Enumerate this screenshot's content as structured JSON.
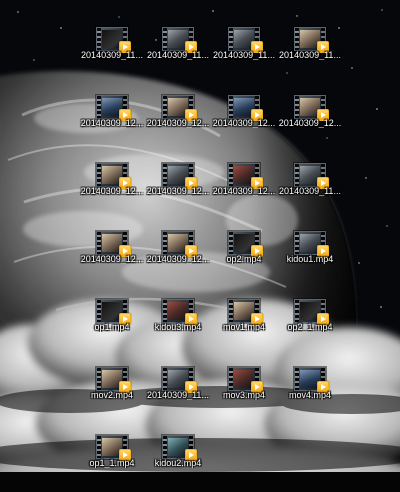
{
  "desktop": {
    "icons": [
      {
        "label": "20140309_11...",
        "thumb": "film-frame-icon",
        "tone": "dark"
      },
      {
        "label": "20140309_11...",
        "thumb": "film-frame-icon",
        "tone": "gray"
      },
      {
        "label": "20140309_11...",
        "thumb": "film-frame-icon",
        "tone": "gray"
      },
      {
        "label": "20140309_11...",
        "thumb": "film-frame-icon",
        "tone": "warm"
      },
      {
        "label": "20140309_12...",
        "thumb": "film-frame-icon",
        "tone": "blue"
      },
      {
        "label": "20140309_12...",
        "thumb": "film-frame-icon",
        "tone": "warm"
      },
      {
        "label": "20140309_12...",
        "thumb": "film-frame-icon",
        "tone": "blue"
      },
      {
        "label": "20140309_12...",
        "thumb": "film-frame-icon",
        "tone": "warm"
      },
      {
        "label": "20140309_12...",
        "thumb": "film-frame-icon",
        "tone": "warm"
      },
      {
        "label": "20140309_12...",
        "thumb": "film-frame-icon",
        "tone": "gray"
      },
      {
        "label": "20140309_12...",
        "thumb": "film-frame-icon",
        "tone": "red"
      },
      {
        "label": "20140309_11...",
        "thumb": "film-frame-icon",
        "tone": "gray"
      },
      {
        "label": "20140309_12...",
        "thumb": "film-frame-icon",
        "tone": "warm"
      },
      {
        "label": "20140309_12...",
        "thumb": "film-frame-icon",
        "tone": "warm"
      },
      {
        "label": "op2.mp4",
        "thumb": "film-frame-icon",
        "tone": "dark"
      },
      {
        "label": "kidou1.mp4",
        "thumb": "film-frame-icon",
        "tone": "gray"
      },
      {
        "label": "op1.mp4",
        "thumb": "film-frame-icon",
        "tone": "dark"
      },
      {
        "label": "kidou3.mp4",
        "thumb": "film-frame-icon",
        "tone": "red"
      },
      {
        "label": "mov1.mp4",
        "thumb": "film-frame-icon",
        "tone": "warm"
      },
      {
        "label": "op2_1.mp4",
        "thumb": "film-frame-icon",
        "tone": "dark"
      },
      {
        "label": "mov2.mp4",
        "thumb": "film-frame-icon",
        "tone": "warm"
      },
      {
        "label": "20140309_11...",
        "thumb": "film-frame-icon",
        "tone": "gray"
      },
      {
        "label": "mov3.mp4",
        "thumb": "film-frame-icon",
        "tone": "red"
      },
      {
        "label": "mov4.mp4",
        "thumb": "film-frame-icon",
        "tone": "blue"
      },
      {
        "label": "op1_1.mp4",
        "thumb": "film-frame-icon",
        "tone": "warm"
      },
      {
        "label": "kidou2.mp4",
        "thumb": "film-frame-icon",
        "tone": "teal"
      }
    ]
  },
  "colors": {
    "label_text": "#ffffff",
    "label_shadow": "#000000",
    "play_badge": "#f4a719"
  }
}
